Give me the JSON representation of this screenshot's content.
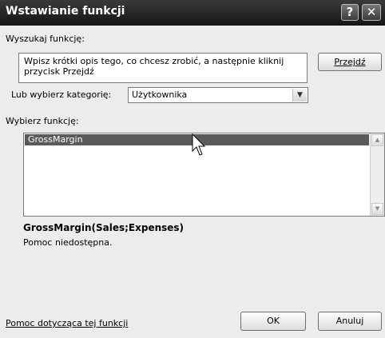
{
  "dialog": {
    "title": "Wstawianie funkcji",
    "help_glyph": "?",
    "close_glyph": "✕",
    "search_label": "Wyszukaj funkcję:",
    "search_text": "Wpisz krótki opis tego, co chcesz zrobić, a następnie kliknij przycisk Przejdź",
    "go_button": "Przejdź",
    "category_label": "Lub wybierz kategorię:",
    "category_value": "Użytkownika",
    "select_label": "Wybierz funkcję:",
    "functions": [
      "GrossMargin"
    ],
    "selected_function": "GrossMargin",
    "signature": "GrossMargin(Sales;Expenses)",
    "description": "Pomoc niedostępna.",
    "help_link": "Pomoc dotycząca tej funkcji",
    "ok_button": "OK",
    "cancel_button": "Anuluj"
  },
  "colors": {
    "titlebar": "#1e1e1e",
    "selection": "#5a5a5a",
    "dialog_bg": "#ececec"
  }
}
